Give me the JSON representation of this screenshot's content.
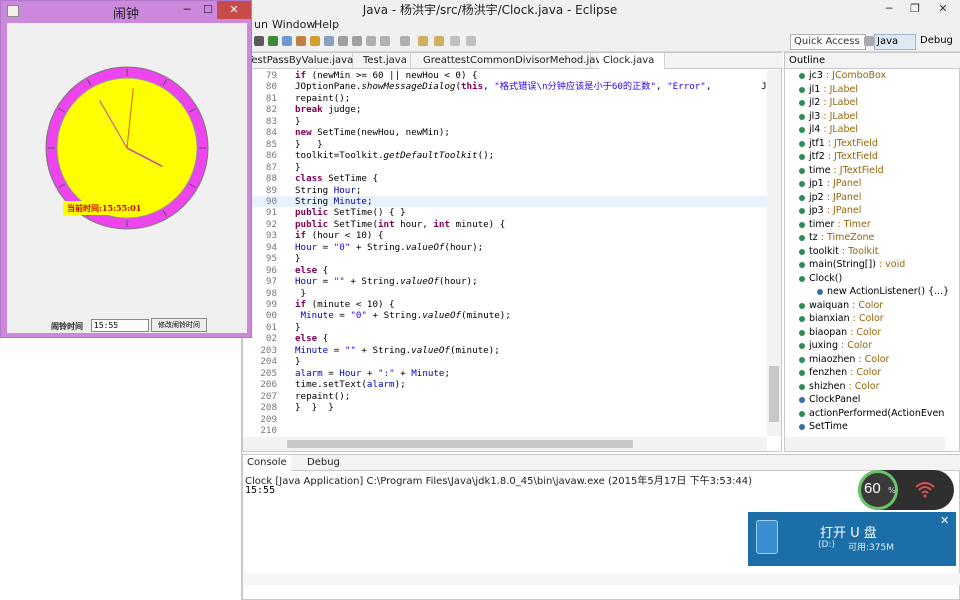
{
  "eclipse": {
    "title": "Java - 杨洪宇/src/杨洪宇/Clock.java - Eclipse",
    "menu": [
      "un",
      "Window",
      "Help"
    ],
    "quick_access": "Quick Access",
    "perspective_java": "Java",
    "perspective_debug": "Debug"
  },
  "editor": {
    "tabs": [
      "TestPassByValue.java",
      "Test.java",
      "GreattestCommonDivisorMehod.java",
      "Clock.java"
    ],
    "active_tab": "Clock.java",
    "highlighted_line": "90"
  },
  "code_lines": [
    {
      "n": "79",
      "t": "if (newMin >= 60 || newHou < 0) {"
    },
    {
      "n": "80",
      "t": "JOptionPane.showMessageDialog(this, \"格式错误\\n分钟应该是小于60的正数\", \"Error\",         JOpt:"
    },
    {
      "n": "81",
      "t": "repaint();"
    },
    {
      "n": "82",
      "t": "break judge;"
    },
    {
      "n": "83",
      "t": "}"
    },
    {
      "n": "84",
      "t": "new SetTime(newHou, newMin);"
    },
    {
      "n": "85",
      "t": "}   }"
    },
    {
      "n": "86",
      "t": "toolkit=Toolkit.getDefaultToolkit();"
    },
    {
      "n": "87",
      "t": "}"
    },
    {
      "n": "88",
      "t": "class SetTime {"
    },
    {
      "n": "89",
      "t": "String Hour;"
    },
    {
      "n": "90",
      "t": "String Minute;"
    },
    {
      "n": "91",
      "t": "public SetTime() { }"
    },
    {
      "n": "92",
      "t": "public SetTime(int hour, int minute) {"
    },
    {
      "n": "93",
      "t": "if (hour < 10) {"
    },
    {
      "n": "94",
      "t": "Hour = \"0\" + String.valueOf(hour);"
    },
    {
      "n": "95",
      "t": "}"
    },
    {
      "n": "96",
      "t": "else {"
    },
    {
      "n": "97",
      "t": "Hour = \"\" + String.valueOf(hour);"
    },
    {
      "n": "98",
      "t": " }"
    },
    {
      "n": "99",
      "t": "if (minute < 10) {"
    },
    {
      "n": "00",
      "t": " Minute = \"0\" + String.valueOf(minute);"
    },
    {
      "n": "01",
      "t": "}"
    },
    {
      "n": "02",
      "t": "else {"
    },
    {
      "n": "203",
      "t": "Minute = \"\" + String.valueOf(minute);"
    },
    {
      "n": "204",
      "t": "}"
    },
    {
      "n": "205",
      "t": "alarm = Hour + \":\" + Minute;"
    },
    {
      "n": "206",
      "t": "time.setText(alarm);"
    },
    {
      "n": "207",
      "t": "repaint();"
    },
    {
      "n": "208",
      "t": "}  }  }"
    },
    {
      "n": "209",
      "t": ""
    },
    {
      "n": "210",
      "t": ""
    }
  ],
  "outline": {
    "title": "Outline",
    "items": [
      {
        "name": "jc3",
        "type": " : JComboBox",
        "indent": 1,
        "icon": "field"
      },
      {
        "name": "jl1",
        "type": " : JLabel",
        "indent": 1,
        "icon": "field"
      },
      {
        "name": "jl2",
        "type": " : JLabel",
        "indent": 1,
        "icon": "field"
      },
      {
        "name": "jl3",
        "type": " : JLabel",
        "indent": 1,
        "icon": "field"
      },
      {
        "name": "jl4",
        "type": " : JLabel",
        "indent": 1,
        "icon": "field"
      },
      {
        "name": "jtf1",
        "type": " : JTextField",
        "indent": 1,
        "icon": "field"
      },
      {
        "name": "jtf2",
        "type": " : JTextField",
        "indent": 1,
        "icon": "field"
      },
      {
        "name": "time",
        "type": " : JTextField",
        "indent": 1,
        "icon": "field"
      },
      {
        "name": "jp1",
        "type": " : JPanel",
        "indent": 1,
        "icon": "field"
      },
      {
        "name": "jp2",
        "type": " : JPanel",
        "indent": 1,
        "icon": "field"
      },
      {
        "name": "jp3",
        "type": " : JPanel",
        "indent": 1,
        "icon": "field"
      },
      {
        "name": "timer",
        "type": " : Timer",
        "indent": 1,
        "icon": "field"
      },
      {
        "name": "tz",
        "type": " : TimeZone",
        "indent": 1,
        "icon": "field"
      },
      {
        "name": "toolkit",
        "type": " : Toolkit",
        "indent": 1,
        "icon": "field"
      },
      {
        "name": "main(String[])",
        "type": " : void",
        "indent": 1,
        "icon": "method"
      },
      {
        "name": "Clock()",
        "type": "",
        "indent": 1,
        "icon": "method"
      },
      {
        "name": "new ActionListener() {...}",
        "type": "",
        "indent": 2,
        "icon": "class"
      },
      {
        "name": "waiquan",
        "type": " : Color",
        "indent": 1,
        "icon": "field"
      },
      {
        "name": "bianxian",
        "type": " : Color",
        "indent": 1,
        "icon": "field"
      },
      {
        "name": "biaopan",
        "type": " : Color",
        "indent": 1,
        "icon": "field"
      },
      {
        "name": "juxing",
        "type": " : Color",
        "indent": 1,
        "icon": "field"
      },
      {
        "name": "miaozhen",
        "type": " : Color",
        "indent": 1,
        "icon": "field"
      },
      {
        "name": "fenzhen",
        "type": " : Color",
        "indent": 1,
        "icon": "field"
      },
      {
        "name": "shizhen",
        "type": " : Color",
        "indent": 1,
        "icon": "field"
      },
      {
        "name": "ClockPanel",
        "type": "",
        "indent": 1,
        "icon": "class"
      },
      {
        "name": "actionPerformed(ActionEven",
        "type": "",
        "indent": 1,
        "icon": "method"
      },
      {
        "name": "SetTime",
        "type": "",
        "indent": 1,
        "icon": "class"
      }
    ]
  },
  "console": {
    "tabs": [
      "Console",
      "Debug"
    ],
    "description": "Clock [Java Application] C:\\Program Files\\Java\\jdk1.8.0_45\\bin\\javaw.exe (2015年5月17日 下午3:53:44)",
    "output": "15:55"
  },
  "clock_window": {
    "title": "闹钟",
    "current_time_label": "当前时间:15:55:01",
    "alarm_label": "闹铃时间",
    "alarm_value": "15:55",
    "alarm_button": "修改闹铃时间",
    "clock_time": {
      "hours": 3,
      "minutes": 55,
      "seconds": 1
    },
    "colors": {
      "ring": "#ee44ee",
      "face": "#ffff00",
      "hour_hand": "#cc44aa",
      "minute_hand": "#cc44aa",
      "second_hand": "#cc6600"
    }
  },
  "widgets": {
    "gauge_value": "60",
    "gauge_unit": "%",
    "usb_title": "打开 U 盘",
    "usb_drive": "(D:)",
    "usb_free": "可用:375M"
  }
}
